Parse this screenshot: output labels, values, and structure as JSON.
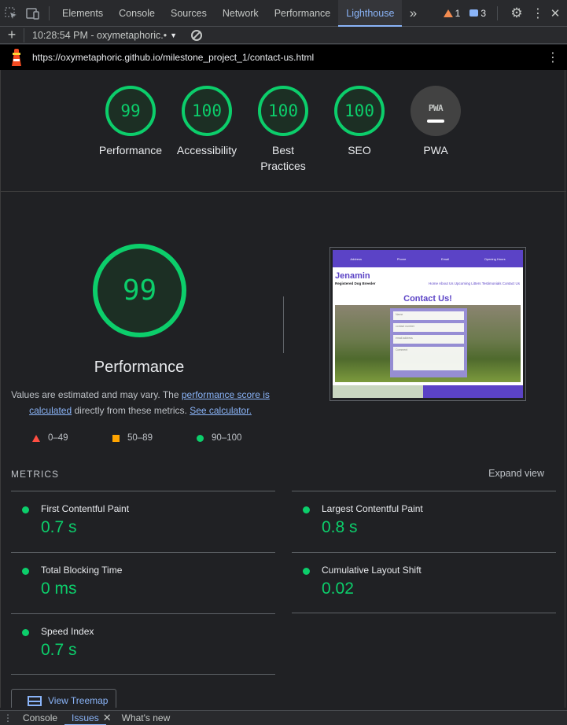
{
  "devtools": {
    "tabs": [
      "Elements",
      "Console",
      "Sources",
      "Network",
      "Performance",
      "Lighthouse"
    ],
    "active_tab": "Lighthouse",
    "more_tabs_icon": "double-chevron-right",
    "warnings_count": "1",
    "messages_count": "3"
  },
  "toolbar": {
    "report_time": "10:28:54 PM - oxymetaphoric.•",
    "add_icon": "plus",
    "clear_icon": "block"
  },
  "urlbar": {
    "url": "https://oxymetaphoric.github.io/milestone_project_1/contact-us.html"
  },
  "scores": [
    {
      "value": "99",
      "label": "Performance"
    },
    {
      "value": "100",
      "label": "Accessibility"
    },
    {
      "value": "100",
      "label": "Best\nPractices"
    },
    {
      "value": "100",
      "label": "SEO"
    },
    {
      "value": "",
      "label": "PWA",
      "badge": "PWA"
    }
  ],
  "performance": {
    "score": "99",
    "title": "Performance",
    "note_prefix": "Values are estimated and may vary. The ",
    "note_link1": "performance score is calculated",
    "note_middle": " directly from these metrics. ",
    "note_link2": "See calculator."
  },
  "legend": {
    "fail": "0–49",
    "average": "50–89",
    "pass": "90–100"
  },
  "thumbnail": {
    "brand": "Jenamin",
    "subtitle": "Registered Dog Breeder",
    "nav": "Home   About Us   Upcoming Litters   Testimonials   Contact Us",
    "heading": "Contact Us!",
    "fields": [
      "Name",
      "contact number",
      "email address",
      "Comment"
    ],
    "top_items": [
      "Address",
      "Phone",
      "Email",
      "Opening Hours"
    ]
  },
  "metrics": {
    "label": "METRICS",
    "expand": "Expand view",
    "items": [
      {
        "name": "First Contentful Paint",
        "value": "0.7 s"
      },
      {
        "name": "Largest Contentful Paint",
        "value": "0.8 s"
      },
      {
        "name": "Total Blocking Time",
        "value": "0 ms"
      },
      {
        "name": "Cumulative Layout Shift",
        "value": "0.02"
      },
      {
        "name": "Speed Index",
        "value": "0.7 s"
      }
    ]
  },
  "treemap_button": "View Treemap",
  "drawer": {
    "tabs": [
      "Console",
      "Issues",
      "What's new"
    ],
    "active": "Issues"
  },
  "colors": {
    "pass": "#0cce6b",
    "average": "#ffa400",
    "fail": "#ff4e42",
    "link": "#8ab4f8"
  }
}
